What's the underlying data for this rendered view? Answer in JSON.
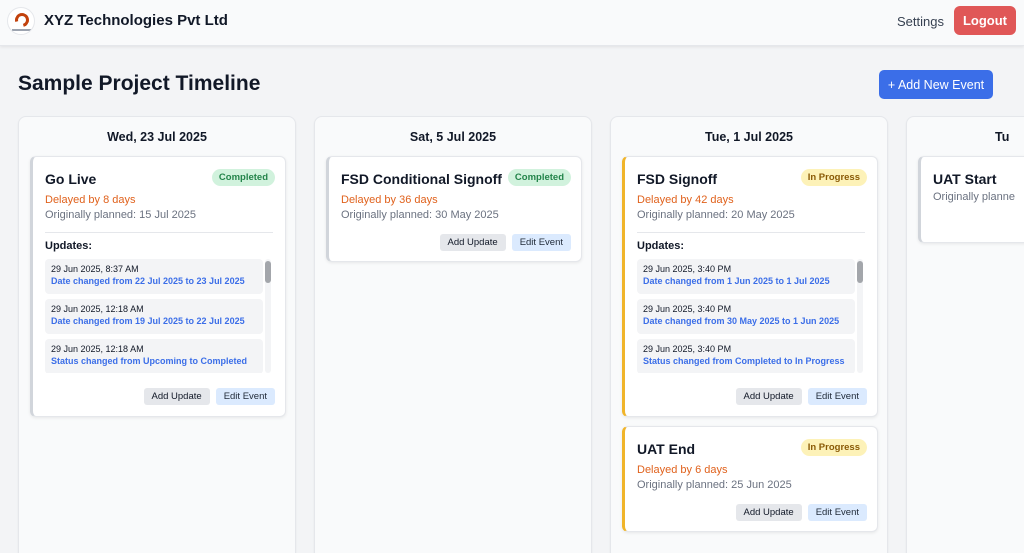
{
  "header": {
    "company": "XYZ Technologies Pvt Ltd",
    "settings": "Settings",
    "logout": "Logout"
  },
  "page": {
    "title": "Sample Project Timeline",
    "add_event": "+ Add New Event"
  },
  "common": {
    "add_update": "Add Update",
    "edit_event": "Edit Event",
    "updates_label": "Updates:"
  },
  "colors": {
    "accent": "#3b6ee8",
    "logout": "#e05757",
    "delay": "#e0621d",
    "in_progress_border": "#f0b429"
  },
  "columns": [
    {
      "date": "Wed, 23 Jul 2025",
      "events": [
        {
          "title": "Go Live",
          "status": "Completed",
          "delay": "Delayed by 8 days",
          "planned": "Originally planned: 15 Jul 2025",
          "updates": [
            {
              "time": "29 Jun 2025, 8:37 AM",
              "text": "Date changed from 22 Jul 2025 to 23 Jul 2025"
            },
            {
              "time": "29 Jun 2025, 12:18 AM",
              "text": "Date changed from 19 Jul 2025 to 22 Jul 2025"
            },
            {
              "time": "29 Jun 2025, 12:18 AM",
              "text": "Status changed from Upcoming to Completed"
            }
          ]
        }
      ]
    },
    {
      "date": "Sat, 5 Jul 2025",
      "events": [
        {
          "title": "FSD Conditional Signoff",
          "status": "Completed",
          "delay": "Delayed by 36 days",
          "planned": "Originally planned: 30 May 2025"
        }
      ]
    },
    {
      "date": "Tue, 1 Jul 2025",
      "events": [
        {
          "title": "FSD Signoff",
          "status": "In Progress",
          "delay": "Delayed by 42 days",
          "planned": "Originally planned: 20 May 2025",
          "updates": [
            {
              "time": "29 Jun 2025, 3:40 PM",
              "text": "Date changed from 1 Jun 2025 to 1 Jul 2025"
            },
            {
              "time": "29 Jun 2025, 3:40 PM",
              "text": "Date changed from 30 May 2025 to 1 Jun 2025"
            },
            {
              "time": "29 Jun 2025, 3:40 PM",
              "text": "Status changed from Completed to In Progress"
            }
          ]
        },
        {
          "title": "UAT End",
          "status": "In Progress",
          "delay": "Delayed by 6 days",
          "planned": "Originally planned: 25 Jun 2025"
        }
      ]
    },
    {
      "date": "Tu",
      "events": [
        {
          "title": "UAT Start",
          "planned": "Originally planne"
        }
      ]
    }
  ]
}
